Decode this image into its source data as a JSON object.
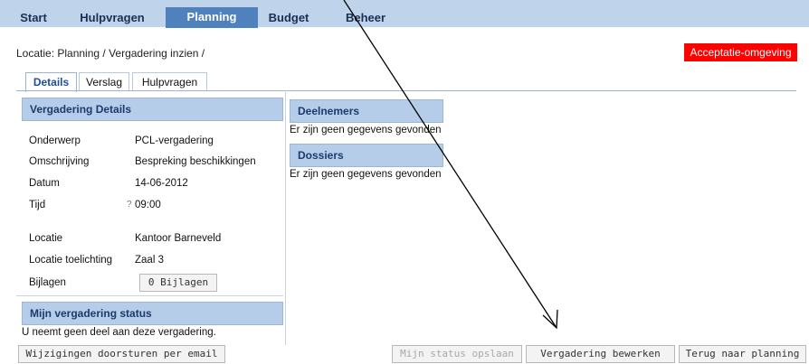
{
  "nav": {
    "tabs": [
      {
        "label": "Start"
      },
      {
        "label": "Hulpvragen"
      },
      {
        "label": "Planning"
      },
      {
        "label": "Budget"
      },
      {
        "label": "Beheer"
      }
    ],
    "active": "Planning"
  },
  "breadcrumb": "Locatie: Planning / Vergadering inzien /",
  "environment_badge": "Acceptatie-omgeving",
  "subtabs": [
    {
      "label": "Details"
    },
    {
      "label": "Verslag"
    },
    {
      "label": "Hulpvragen"
    }
  ],
  "details": {
    "title": "Vergadering Details",
    "fields": {
      "onderwerp_label": "Onderwerp",
      "onderwerp_value": "PCL-vergadering",
      "omschrijving_label": "Omschrijving",
      "omschrijving_value": "Bespreking beschikkingen",
      "datum_label": "Datum",
      "datum_value": "14-06-2012",
      "tijd_label": "Tijd",
      "tijd_marker": "?",
      "tijd_value": "09:00",
      "locatie_label": "Locatie",
      "locatie_value": "Kantoor Barneveld",
      "toelichting_label": "Locatie toelichting",
      "toelichting_value": "Zaal 3",
      "bijlagen_label": "Bijlagen",
      "bijlagen_button": "0 Bijlagen"
    }
  },
  "status": {
    "title": "Mijn vergadering status",
    "text": "U neemt geen deel aan deze vergadering."
  },
  "deelnemers": {
    "title": "Deelnemers",
    "empty": "Er zijn geen gegevens gevonden"
  },
  "dossiers": {
    "title": "Dossiers",
    "empty": "Er zijn geen gegevens gevonden"
  },
  "buttons": {
    "email": "Wijzigingen doorsturen per email",
    "save_status": "Mijn status opslaan",
    "edit": "Vergadering bewerken",
    "back": "Terug naar planning"
  },
  "colors": {
    "nav_bg": "#bfd3ea",
    "nav_active": "#4f81bd",
    "section_header": "#b5cde8",
    "badge": "#ff0000"
  }
}
